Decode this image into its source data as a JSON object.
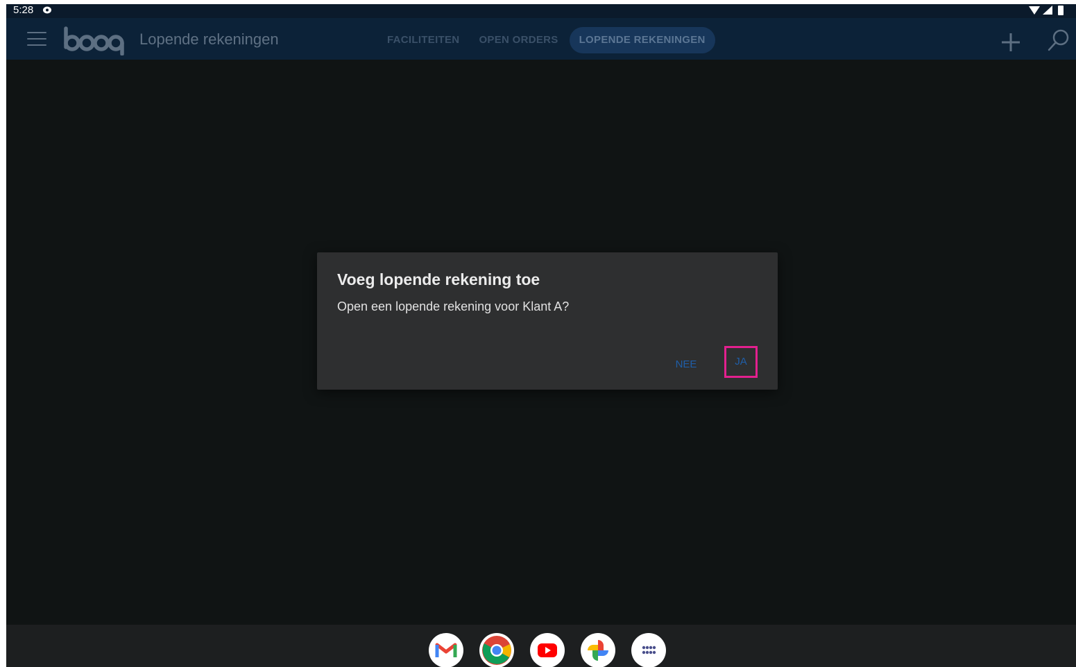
{
  "status_bar": {
    "time": "5:28",
    "icons": [
      "notification-bubble-icon",
      "wifi-icon",
      "signal-icon",
      "battery-icon"
    ]
  },
  "app_bar": {
    "logo_text": "booq",
    "title": "Lopende rekeningen",
    "tabs": [
      {
        "label": "FACILITEITEN",
        "active": false
      },
      {
        "label": "OPEN ORDERS",
        "active": false
      },
      {
        "label": "LOPENDE REKENINGEN",
        "active": true
      }
    ],
    "icons": [
      "menu-icon",
      "plus-icon",
      "search-icon"
    ]
  },
  "dialog": {
    "title": "Voeg lopende rekening toe",
    "message": "Open een lopende rekening voor Klant A?",
    "negative_button": "NEE",
    "positive_button": "JA",
    "highlight_color": "#e3208f",
    "button_color": "#1f5ea8"
  },
  "dock": {
    "apps": [
      "gmail-icon",
      "chrome-icon",
      "youtube-icon",
      "photos-icon",
      "app-drawer-icon"
    ]
  },
  "colors": {
    "appbar": "#0c2238",
    "background": "#101414",
    "dialog": "#2e2f30"
  }
}
